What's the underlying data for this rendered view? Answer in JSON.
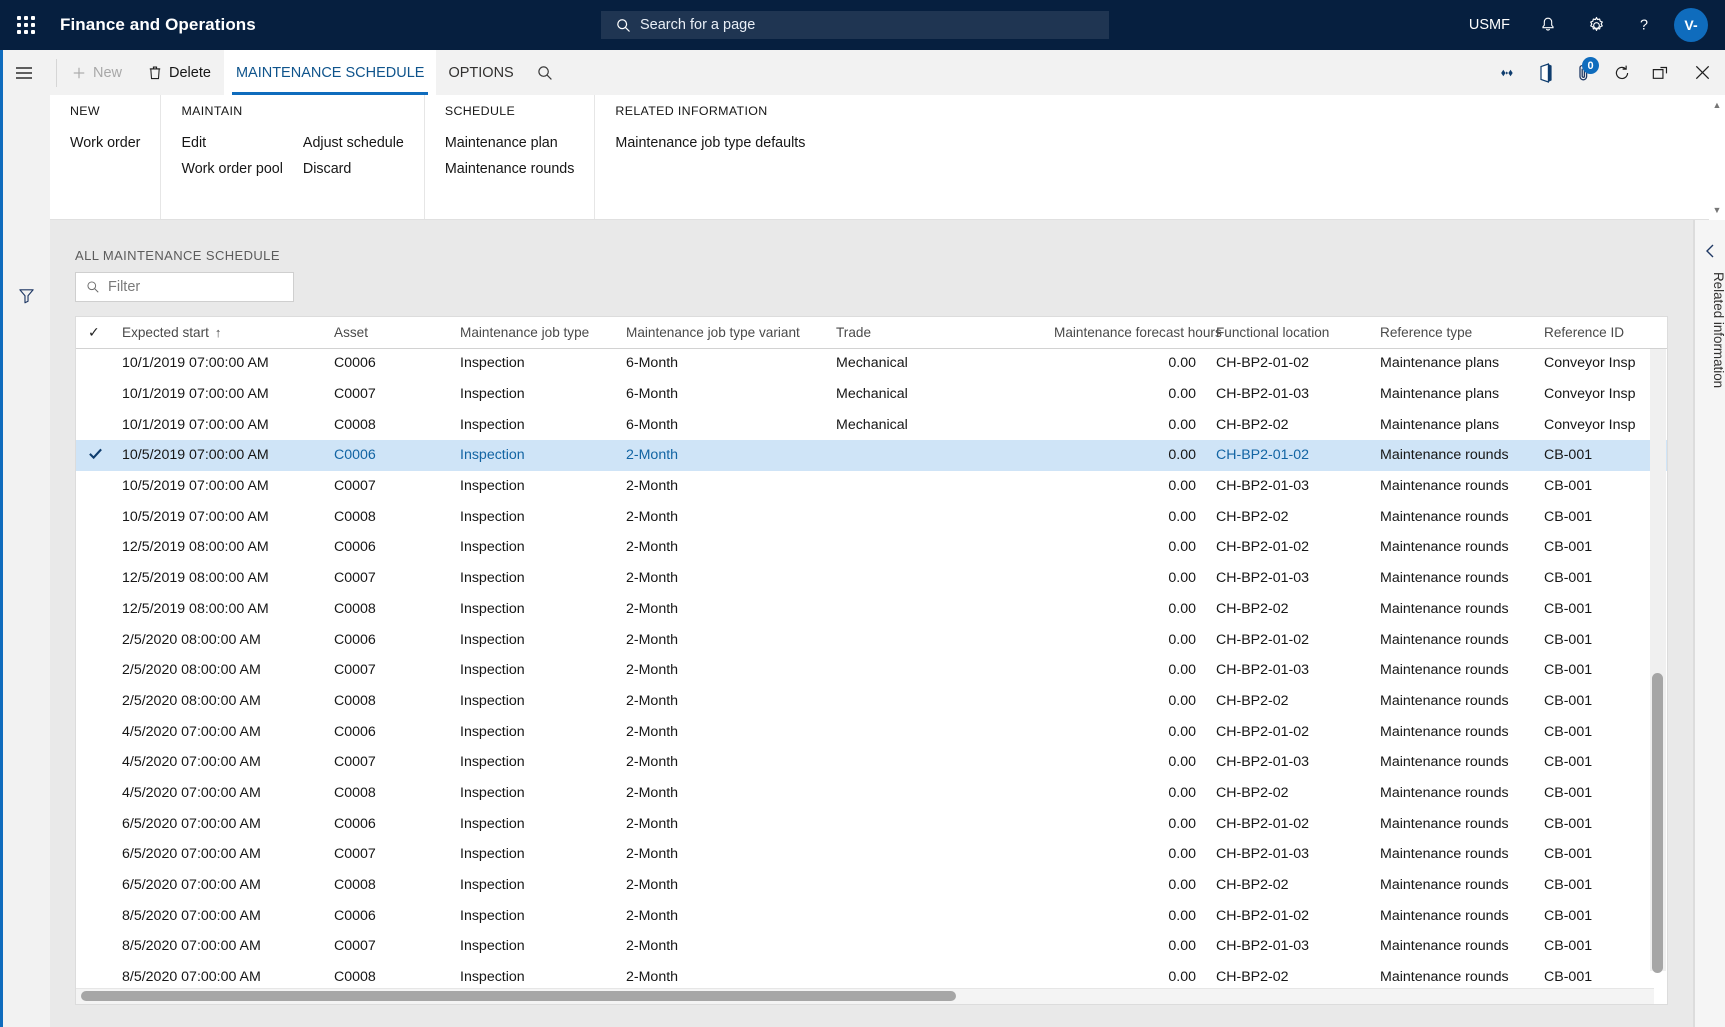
{
  "topbar": {
    "waffle_icon": "waffle-grid-icon",
    "app_title": "Finance and Operations",
    "search": {
      "icon": "search-icon",
      "placeholder": "Search for a page"
    },
    "company": "USMF",
    "icons": [
      {
        "name": "notifications-bell-icon",
        "glyph": "bell"
      },
      {
        "name": "settings-gear-icon",
        "glyph": "gear"
      },
      {
        "name": "help-question-icon",
        "glyph": "question"
      }
    ],
    "avatar_initials": "V-"
  },
  "left_rail": {
    "menu_icon": "hamburger-menu-icon",
    "filter_icon": "filter-funnel-icon"
  },
  "commandbar": {
    "menu_icon": "hamburger-menu-icon",
    "new_label": "New",
    "delete_label": "Delete",
    "tabs": [
      {
        "label": "MAINTENANCE SCHEDULE",
        "active": true
      },
      {
        "label": "OPTIONS",
        "active": false
      }
    ],
    "search_icon": "search-icon",
    "right_icons": [
      {
        "name": "share-icon",
        "badge": null
      },
      {
        "name": "office-app-icon",
        "badge": null
      },
      {
        "name": "attachment-icon",
        "badge": "0"
      },
      {
        "name": "refresh-icon",
        "badge": null
      },
      {
        "name": "popout-icon",
        "badge": null
      },
      {
        "name": "close-icon",
        "badge": null
      }
    ]
  },
  "action_pane": {
    "groups": [
      {
        "title": "NEW",
        "columns": [
          {
            "items": [
              "Work order"
            ]
          }
        ]
      },
      {
        "title": "MAINTAIN",
        "columns": [
          {
            "items": [
              "Edit",
              "Work order pool"
            ]
          },
          {
            "items": [
              "Adjust schedule",
              "Discard"
            ]
          }
        ]
      },
      {
        "title": "SCHEDULE",
        "columns": [
          {
            "items": [
              "Maintenance plan",
              "Maintenance rounds"
            ]
          }
        ]
      },
      {
        "title": "RELATED INFORMATION",
        "columns": [
          {
            "items": [
              "Maintenance job type defaults"
            ]
          }
        ]
      }
    ]
  },
  "grid_panel": {
    "caption": "ALL MAINTENANCE SCHEDULE",
    "filter": {
      "icon": "search-icon",
      "placeholder": "Filter",
      "value": ""
    }
  },
  "grid": {
    "columns": [
      {
        "key": "check",
        "label": "",
        "cls": "c-check"
      },
      {
        "key": "start",
        "label": "Expected start",
        "cls": "c-start",
        "sorted": "asc",
        "sort_glyph": "↑"
      },
      {
        "key": "asset",
        "label": "Asset",
        "cls": "c-asset"
      },
      {
        "key": "jobtype",
        "label": "Maintenance job type",
        "cls": "c-jobtype"
      },
      {
        "key": "variant",
        "label": "Maintenance job type variant",
        "cls": "c-variant"
      },
      {
        "key": "trade",
        "label": "Trade",
        "cls": "c-trade"
      },
      {
        "key": "hours",
        "label": "Maintenance forecast hours",
        "cls": "c-hours"
      },
      {
        "key": "loc",
        "label": "Functional location",
        "cls": "c-loc"
      },
      {
        "key": "reftype",
        "label": "Reference type",
        "cls": "c-reftype"
      },
      {
        "key": "refid",
        "label": "Reference ID",
        "cls": "c-refid"
      }
    ],
    "header_check_icon": "checkmark-icon",
    "selected_row_index": 3,
    "rows": [
      {
        "start": "10/1/2019 07:00:00 AM",
        "asset": "C0006",
        "jobtype": "Inspection",
        "variant": "6-Month",
        "trade": "Mechanical",
        "hours": "0.00",
        "loc": "CH-BP2-01-02",
        "reftype": "Maintenance plans",
        "refid": "Conveyor Insp"
      },
      {
        "start": "10/1/2019 07:00:00 AM",
        "asset": "C0007",
        "jobtype": "Inspection",
        "variant": "6-Month",
        "trade": "Mechanical",
        "hours": "0.00",
        "loc": "CH-BP2-01-03",
        "reftype": "Maintenance plans",
        "refid": "Conveyor Insp"
      },
      {
        "start": "10/1/2019 07:00:00 AM",
        "asset": "C0008",
        "jobtype": "Inspection",
        "variant": "6-Month",
        "trade": "Mechanical",
        "hours": "0.00",
        "loc": "CH-BP2-02",
        "reftype": "Maintenance plans",
        "refid": "Conveyor Insp"
      },
      {
        "start": "10/5/2019 07:00:00 AM",
        "asset": "C0006",
        "jobtype": "Inspection",
        "variant": "2-Month",
        "trade": "",
        "hours": "0.00",
        "loc": "CH-BP2-01-02",
        "reftype": "Maintenance rounds",
        "refid": "CB-001"
      },
      {
        "start": "10/5/2019 07:00:00 AM",
        "asset": "C0007",
        "jobtype": "Inspection",
        "variant": "2-Month",
        "trade": "",
        "hours": "0.00",
        "loc": "CH-BP2-01-03",
        "reftype": "Maintenance rounds",
        "refid": "CB-001"
      },
      {
        "start": "10/5/2019 07:00:00 AM",
        "asset": "C0008",
        "jobtype": "Inspection",
        "variant": "2-Month",
        "trade": "",
        "hours": "0.00",
        "loc": "CH-BP2-02",
        "reftype": "Maintenance rounds",
        "refid": "CB-001"
      },
      {
        "start": "12/5/2019 08:00:00 AM",
        "asset": "C0006",
        "jobtype": "Inspection",
        "variant": "2-Month",
        "trade": "",
        "hours": "0.00",
        "loc": "CH-BP2-01-02",
        "reftype": "Maintenance rounds",
        "refid": "CB-001"
      },
      {
        "start": "12/5/2019 08:00:00 AM",
        "asset": "C0007",
        "jobtype": "Inspection",
        "variant": "2-Month",
        "trade": "",
        "hours": "0.00",
        "loc": "CH-BP2-01-03",
        "reftype": "Maintenance rounds",
        "refid": "CB-001"
      },
      {
        "start": "12/5/2019 08:00:00 AM",
        "asset": "C0008",
        "jobtype": "Inspection",
        "variant": "2-Month",
        "trade": "",
        "hours": "0.00",
        "loc": "CH-BP2-02",
        "reftype": "Maintenance rounds",
        "refid": "CB-001"
      },
      {
        "start": "2/5/2020 08:00:00 AM",
        "asset": "C0006",
        "jobtype": "Inspection",
        "variant": "2-Month",
        "trade": "",
        "hours": "0.00",
        "loc": "CH-BP2-01-02",
        "reftype": "Maintenance rounds",
        "refid": "CB-001"
      },
      {
        "start": "2/5/2020 08:00:00 AM",
        "asset": "C0007",
        "jobtype": "Inspection",
        "variant": "2-Month",
        "trade": "",
        "hours": "0.00",
        "loc": "CH-BP2-01-03",
        "reftype": "Maintenance rounds",
        "refid": "CB-001"
      },
      {
        "start": "2/5/2020 08:00:00 AM",
        "asset": "C0008",
        "jobtype": "Inspection",
        "variant": "2-Month",
        "trade": "",
        "hours": "0.00",
        "loc": "CH-BP2-02",
        "reftype": "Maintenance rounds",
        "refid": "CB-001"
      },
      {
        "start": "4/5/2020 07:00:00 AM",
        "asset": "C0006",
        "jobtype": "Inspection",
        "variant": "2-Month",
        "trade": "",
        "hours": "0.00",
        "loc": "CH-BP2-01-02",
        "reftype": "Maintenance rounds",
        "refid": "CB-001"
      },
      {
        "start": "4/5/2020 07:00:00 AM",
        "asset": "C0007",
        "jobtype": "Inspection",
        "variant": "2-Month",
        "trade": "",
        "hours": "0.00",
        "loc": "CH-BP2-01-03",
        "reftype": "Maintenance rounds",
        "refid": "CB-001"
      },
      {
        "start": "4/5/2020 07:00:00 AM",
        "asset": "C0008",
        "jobtype": "Inspection",
        "variant": "2-Month",
        "trade": "",
        "hours": "0.00",
        "loc": "CH-BP2-02",
        "reftype": "Maintenance rounds",
        "refid": "CB-001"
      },
      {
        "start": "6/5/2020 07:00:00 AM",
        "asset": "C0006",
        "jobtype": "Inspection",
        "variant": "2-Month",
        "trade": "",
        "hours": "0.00",
        "loc": "CH-BP2-01-02",
        "reftype": "Maintenance rounds",
        "refid": "CB-001"
      },
      {
        "start": "6/5/2020 07:00:00 AM",
        "asset": "C0007",
        "jobtype": "Inspection",
        "variant": "2-Month",
        "trade": "",
        "hours": "0.00",
        "loc": "CH-BP2-01-03",
        "reftype": "Maintenance rounds",
        "refid": "CB-001"
      },
      {
        "start": "6/5/2020 07:00:00 AM",
        "asset": "C0008",
        "jobtype": "Inspection",
        "variant": "2-Month",
        "trade": "",
        "hours": "0.00",
        "loc": "CH-BP2-02",
        "reftype": "Maintenance rounds",
        "refid": "CB-001"
      },
      {
        "start": "8/5/2020 07:00:00 AM",
        "asset": "C0006",
        "jobtype": "Inspection",
        "variant": "2-Month",
        "trade": "",
        "hours": "0.00",
        "loc": "CH-BP2-01-02",
        "reftype": "Maintenance rounds",
        "refid": "CB-001"
      },
      {
        "start": "8/5/2020 07:00:00 AM",
        "asset": "C0007",
        "jobtype": "Inspection",
        "variant": "2-Month",
        "trade": "",
        "hours": "0.00",
        "loc": "CH-BP2-01-03",
        "reftype": "Maintenance rounds",
        "refid": "CB-001"
      },
      {
        "start": "8/5/2020 07:00:00 AM",
        "asset": "C0008",
        "jobtype": "Inspection",
        "variant": "2-Month",
        "trade": "",
        "hours": "0.00",
        "loc": "CH-BP2-02",
        "reftype": "Maintenance rounds",
        "refid": "CB-001"
      }
    ]
  },
  "right_panel": {
    "chevron_icon": "chevron-left-icon",
    "label": "Related information"
  },
  "colors": {
    "brand_navy": "#061f3f",
    "accent_blue": "#0f6cbd",
    "link_blue": "#1264a3",
    "selected_row": "#cfe4f7",
    "chrome_gray": "#f2f2f2"
  }
}
